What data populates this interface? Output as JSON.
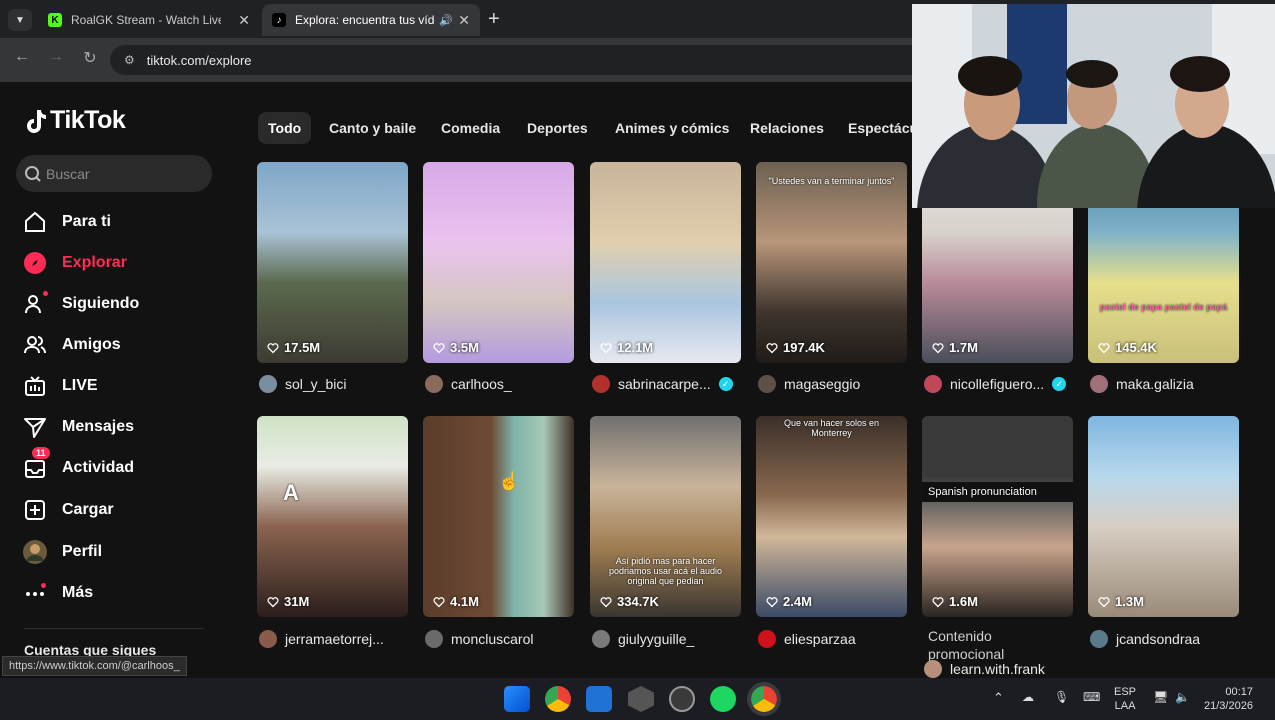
{
  "browser": {
    "tabs": [
      {
        "title": "RoalGK Stream - Watch Live on",
        "active": false,
        "favicon": "kick-icon"
      },
      {
        "title": "Explora: encuentra tus vídeo",
        "active": true,
        "favicon": "tiktok-icon"
      }
    ],
    "url": "tiktok.com/explore"
  },
  "app": {
    "logo_text": "TikTok",
    "search_placeholder": "Buscar",
    "nav": [
      {
        "label": "Para ti",
        "icon": "home-icon",
        "active": false
      },
      {
        "label": "Explorar",
        "icon": "compass-icon",
        "active": true
      },
      {
        "label": "Siguiendo",
        "icon": "following-icon",
        "active": false
      },
      {
        "label": "Amigos",
        "icon": "friends-icon",
        "active": false
      },
      {
        "label": "LIVE",
        "icon": "live-icon",
        "active": false
      },
      {
        "label": "Mensajes",
        "icon": "send-icon",
        "active": false
      },
      {
        "label": "Actividad",
        "icon": "inbox-icon",
        "active": false,
        "badge": "11"
      },
      {
        "label": "Cargar",
        "icon": "plus-square-icon",
        "active": false
      },
      {
        "label": "Perfil",
        "icon": "avatar-icon",
        "active": false
      },
      {
        "label": "Más",
        "icon": "more-icon",
        "active": false
      }
    ],
    "following_title": "Cuentas que sigues",
    "categories": [
      "Todo",
      "Canto y baile",
      "Comedia",
      "Deportes",
      "Animes y cómics",
      "Relaciones",
      "Espectácu"
    ],
    "videos": [
      {
        "likes": "17.5M",
        "user": "sol_y_bici",
        "verified": false,
        "overlay": ""
      },
      {
        "likes": "3.5M",
        "user": "carlhoos_",
        "verified": false,
        "overlay": ""
      },
      {
        "likes": "12.1M",
        "user": "sabrinacarpe...",
        "verified": true,
        "overlay": ""
      },
      {
        "likes": "197.4K",
        "user": "magaseggio",
        "verified": false,
        "overlay": "\"Ustedes van a terminar juntos\""
      },
      {
        "likes": "1.7M",
        "user": "nicollefiguero...",
        "verified": true,
        "overlay": ""
      },
      {
        "likes": "145.4K",
        "user": "maka.galizia",
        "verified": false,
        "overlay": "pastel de papa pastel de papá"
      },
      {
        "likes": "31M",
        "user": "jerramaetorrej...",
        "verified": false,
        "overlay": "A"
      },
      {
        "likes": "4.1M",
        "user": "moncluscarol",
        "verified": false,
        "overlay": ""
      },
      {
        "likes": "334.7K",
        "user": "giulyyguille_",
        "verified": false,
        "overlay": "Así pidió mas para hacer podriamos usar acá el audio original que pedian"
      },
      {
        "likes": "2.4M",
        "user": "eliesparzaa",
        "verified": false,
        "overlay": "Que van hacer solos en Monterrey"
      },
      {
        "likes": "1.6M",
        "user": "learn.with.frank",
        "verified": false,
        "overlay": "Spanish pronunciation"
      },
      {
        "likes": "1.3M",
        "user": "jcandsondraa",
        "verified": false,
        "overlay": ""
      }
    ],
    "promo_label": "Contenido promocional",
    "hover_link": "https://www.tiktok.com/@carlhoos_"
  },
  "taskbar": {
    "lang": "ESP",
    "layout": "LAA",
    "time": "00:17",
    "date": "21/3/2026"
  }
}
